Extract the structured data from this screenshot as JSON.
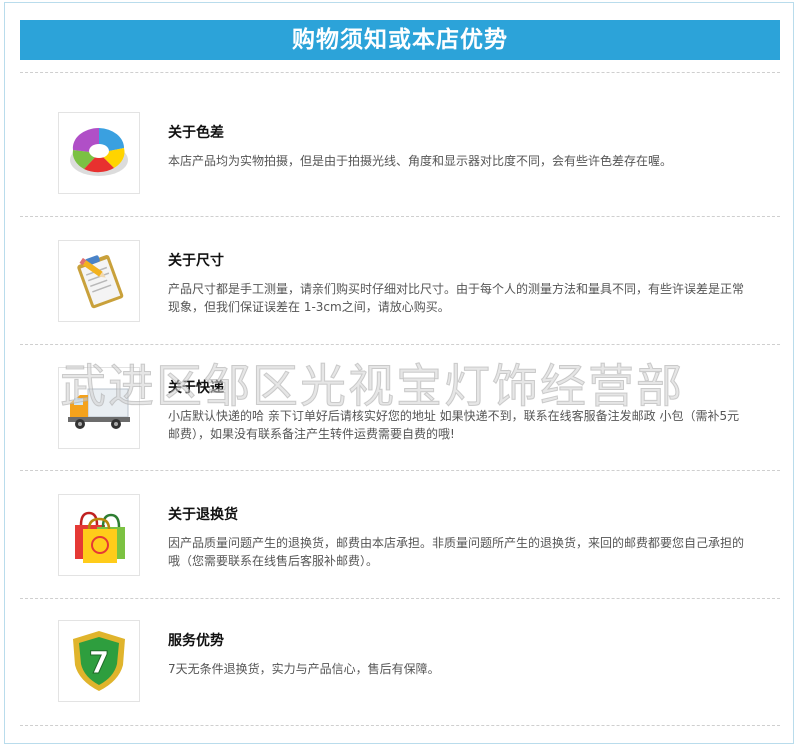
{
  "header": {
    "title": "购物须知或本店优势"
  },
  "items": [
    {
      "title": "关于色差",
      "desc": "本店产品均为实物拍摄，但是由于拍摄光线、角度和显示器对比度不同，会有些许色差存在喔。"
    },
    {
      "title": "关于尺寸",
      "desc": "产品尺寸都是手工测量，请亲们购买时仔细对比尺寸。由于每个人的测量方法和量具不同，有些许误差是正常现象，但我们保证误差在 1-3cm之间，请放心购买。"
    },
    {
      "title": "关于快递",
      "desc": "小店默认快递的哈 亲下订单好后请核实好您的地址 如果快递不到，联系在线客服备注发邮政 小包（需补5元邮费），如果没有联系备注产生转件运费需要自费的哦!"
    },
    {
      "title": "关于退换货",
      "desc": "因产品质量问题产生的退换货，邮费由本店承担。非质量问题所产生的退换货，来回的邮费都要您自己承担的哦（您需要联系在线售后客服补邮费）。"
    },
    {
      "title": "服务优势",
      "desc": "7天无条件退换货，实力与产品信心，售后有保障。"
    }
  ],
  "icons": [
    "pie-chart-icon",
    "clipboard-icon",
    "delivery-truck-icon",
    "shopping-bags-icon",
    "shield-seven-icon"
  ],
  "watermark": "武进区邹区光视宝灯饰经营部",
  "badge_number": "7",
  "colors": {
    "header_bg": "#2ca3d9",
    "frame_border": "#b9dcec"
  }
}
